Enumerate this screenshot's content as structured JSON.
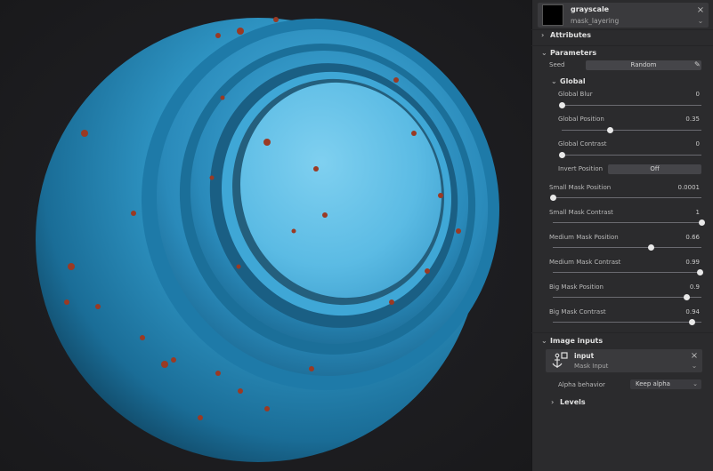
{
  "header": {
    "title": "grayscale",
    "subtitle": "mask_layering"
  },
  "sections": {
    "attributes": "Attributes",
    "parameters": "Parameters",
    "global": "Global",
    "image_inputs": "Image inputs",
    "levels": "Levels"
  },
  "seed": {
    "label": "Seed",
    "button": "Random"
  },
  "global_params": [
    {
      "label": "Global Blur",
      "value": "0",
      "fraction": 0.0
    },
    {
      "label": "Global Position",
      "value": "0.35",
      "fraction": 0.35
    },
    {
      "label": "Global Contrast",
      "value": "0",
      "fraction": 0.0
    }
  ],
  "invert": {
    "label": "Invert Position",
    "value": "Off"
  },
  "params": [
    {
      "label": "Small Mask Position",
      "value": "0.0001",
      "fraction": 0.0001
    },
    {
      "label": "Small Mask Contrast",
      "value": "1",
      "fraction": 1.0
    },
    {
      "label": "Medium Mask Position",
      "value": "0.66",
      "fraction": 0.66
    },
    {
      "label": "Medium Mask Contrast",
      "value": "0.99",
      "fraction": 0.99
    },
    {
      "label": "Big Mask Position",
      "value": "0.9",
      "fraction": 0.9
    },
    {
      "label": "Big Mask Contrast",
      "value": "0.94",
      "fraction": 0.94
    }
  ],
  "input": {
    "title": "input",
    "subtitle": "Mask Input"
  },
  "alpha": {
    "label": "Alpha behavior",
    "value": "Keep alpha"
  },
  "colors": {
    "panel_bg": "#2b2b2d",
    "sphere_blue": "#2f9bcc",
    "rust": "#9a3a24"
  }
}
